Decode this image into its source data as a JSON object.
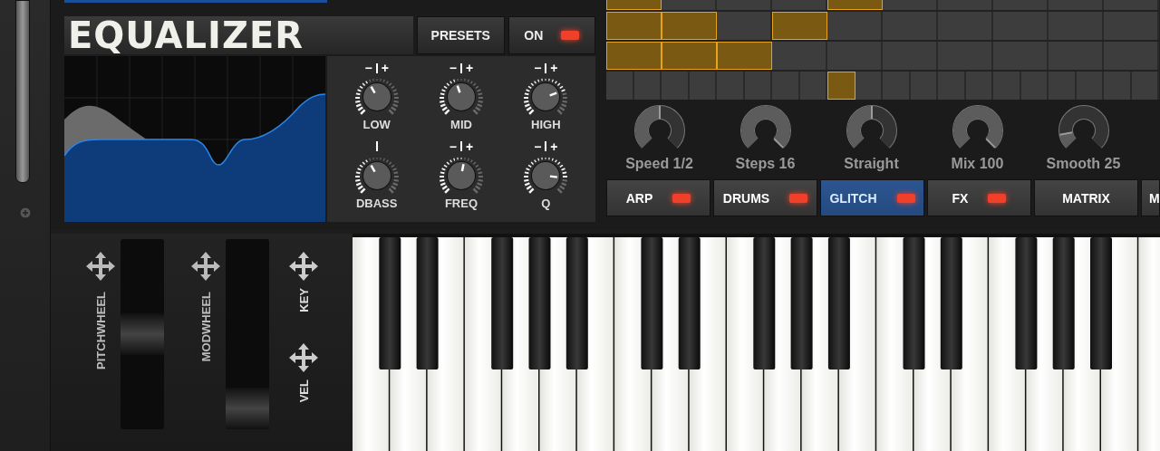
{
  "equalizer": {
    "title": "EQUALIZER",
    "presets_button": "PRESETS",
    "power": {
      "label": "ON",
      "on": true
    },
    "knobs": [
      {
        "label": "LOW",
        "minus": "−",
        "plus": "+",
        "level": 0.39
      },
      {
        "label": "MID",
        "minus": "−",
        "plus": "+",
        "level": 0.43
      },
      {
        "label": "HIGH",
        "minus": "−",
        "plus": "+",
        "level": 0.76
      },
      {
        "label": "DBASS",
        "level": 0.39
      },
      {
        "label": "FREQ",
        "minus": "−",
        "plus": "+",
        "level": 0.54
      },
      {
        "label": "Q",
        "minus": "−",
        "plus": "+",
        "level": 0.86
      }
    ]
  },
  "step_grid": {
    "rows": [
      {
        "cells": [
          {
            "on": true
          },
          {
            "on": false
          },
          {
            "on": false
          },
          {
            "on": false
          },
          {
            "on": true
          },
          {
            "on": false
          },
          {
            "on": false
          },
          {
            "on": false
          },
          {
            "on": false
          },
          {
            "on": false
          }
        ]
      },
      {
        "cells": [
          {
            "on": true
          },
          {
            "on": true
          },
          {
            "on": false
          },
          {
            "on": true
          },
          {
            "on": false
          },
          {
            "on": false
          },
          {
            "on": false
          },
          {
            "on": false
          },
          {
            "on": false
          },
          {
            "on": false
          }
        ]
      },
      {
        "cells": [
          {
            "on": true
          },
          {
            "on": true
          },
          {
            "on": true
          },
          {
            "on": false
          },
          {
            "on": false
          },
          {
            "on": false
          },
          {
            "on": false
          },
          {
            "on": false
          },
          {
            "on": false
          },
          {
            "on": false
          }
        ]
      },
      {
        "cells": [
          {
            "on": false
          },
          {
            "on": false
          },
          {
            "on": false
          },
          {
            "on": false
          },
          {
            "on": false
          },
          {
            "on": false
          },
          {
            "on": false
          },
          {
            "on": false
          },
          {
            "on": true
          },
          {
            "on": false
          },
          {
            "on": false
          },
          {
            "on": false
          },
          {
            "on": false
          },
          {
            "on": false
          },
          {
            "on": false
          },
          {
            "on": false
          },
          {
            "on": false
          },
          {
            "on": false
          },
          {
            "on": false
          },
          {
            "on": false
          }
        ]
      }
    ]
  },
  "arp_knobs": [
    {
      "label": "Speed 1/2",
      "level": 0.5
    },
    {
      "label": "Steps 16",
      "level": 1
    },
    {
      "label": "Straight",
      "level": 0.5
    },
    {
      "label": "Mix 100",
      "level": 1
    },
    {
      "label": "Smooth 25",
      "level": 0.13
    }
  ],
  "tabs": [
    {
      "label": "ARP",
      "selected": false,
      "led": true
    },
    {
      "label": "DRUMS",
      "selected": false,
      "led": true
    },
    {
      "label": "GLITCH",
      "selected": true,
      "led": true
    },
    {
      "label": "FX",
      "selected": false,
      "led": true
    },
    {
      "label": "MATRIX",
      "selected": false,
      "led": false
    },
    {
      "label": "M",
      "selected": false,
      "led": false
    }
  ],
  "wheels": [
    {
      "label": "PITCHWHEEL",
      "level": 0.5
    },
    {
      "label": "MODWHEEL",
      "level": 0
    }
  ],
  "touch_controls": [
    {
      "label": "KEY"
    },
    {
      "label": "VEL"
    }
  ]
}
